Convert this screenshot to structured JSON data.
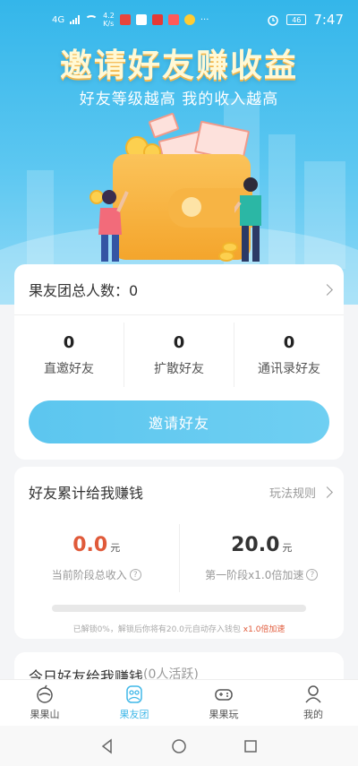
{
  "status_bar": {
    "network": "4G",
    "speed_value": "4.2",
    "speed_unit": "K/s",
    "more": "···",
    "battery": "46",
    "time": "7:47"
  },
  "hero": {
    "title": "邀请好友赚收益",
    "subtitle": "好友等级越高 我的收入越高"
  },
  "team": {
    "total_label": "果友团总人数：",
    "total_value": "0",
    "stats": [
      {
        "value": "0",
        "label": "直邀好友"
      },
      {
        "value": "0",
        "label": "扩散好友"
      },
      {
        "value": "0",
        "label": "通讯录好友"
      }
    ],
    "invite_button": "邀请好友"
  },
  "earnings": {
    "title": "好友累计给我赚钱",
    "rules_link": "玩法规则",
    "left_value": "0.0",
    "left_unit": "元",
    "left_desc": "当前阶段总收入",
    "right_value": "20.0",
    "right_unit": "元",
    "right_desc": "第一阶段x1.0倍加速",
    "progress_fraction": 0,
    "note_text": "已解锁0%，解锁后你将有20.0元自动存入钱包",
    "note_highlight": "x1.0倍加速"
  },
  "today": {
    "title": "今日好友给我赚钱",
    "sub": "(0人活跃)"
  },
  "tabs": [
    {
      "label": "果果山",
      "icon": "fruit-mountain-icon",
      "active": false
    },
    {
      "label": "果友团",
      "icon": "friends-team-icon",
      "active": true
    },
    {
      "label": "果果玩",
      "icon": "gamepad-icon",
      "active": false
    },
    {
      "label": "我的",
      "icon": "profile-icon",
      "active": false
    }
  ],
  "colors": {
    "hero_blue": "#34b6ea",
    "accent": "#5cc6ef",
    "highlight_red": "#e05a3a",
    "tab_active": "#41b8e8"
  }
}
